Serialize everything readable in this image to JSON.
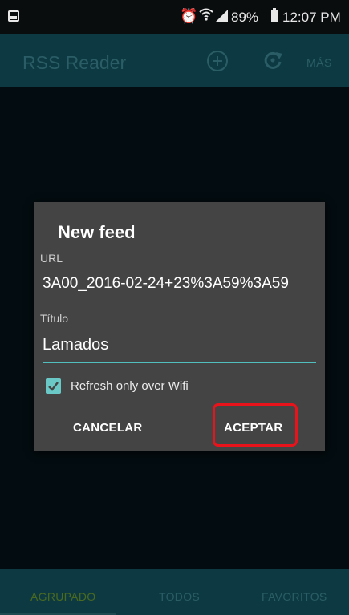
{
  "status_bar": {
    "battery": "89%",
    "time": "12:07 PM"
  },
  "app_bar": {
    "title": "RSS Reader",
    "more_label": "MÁS"
  },
  "dialog": {
    "title": "New feed",
    "url_label": "URL",
    "url_value": "3A00_2016-02-24+23%3A59%3A59",
    "titulo_label": "Título",
    "titulo_value": "Lamados",
    "checkbox_label": "Refresh only over Wifi",
    "checkbox_checked": true,
    "cancel_label": "CANCELAR",
    "accept_label": "ACEPTAR"
  },
  "tabs": [
    {
      "label": "AGRUPADO",
      "selected": true
    },
    {
      "label": "TODOS",
      "selected": false
    },
    {
      "label": "FAVORITOS",
      "selected": false
    }
  ],
  "colors": {
    "accent": "#50bfbe",
    "app_bar": "#0d3a42",
    "dialog_bg": "#444444",
    "highlight": "#e8131b"
  }
}
